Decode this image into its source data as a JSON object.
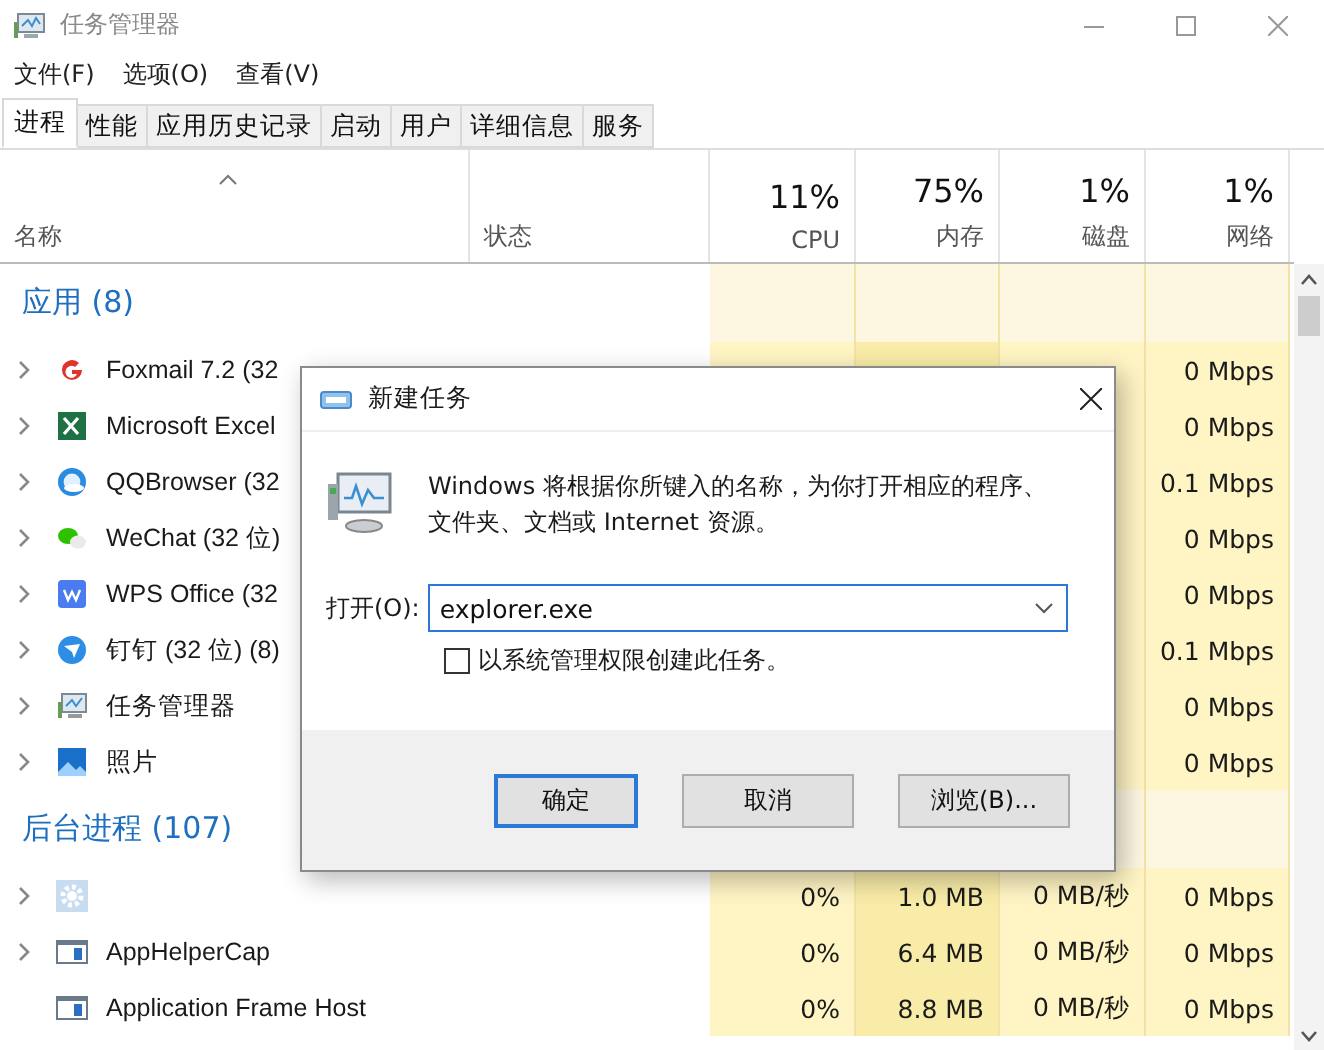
{
  "window": {
    "title": "任务管理器"
  },
  "menu": [
    "文件(F)",
    "选项(O)",
    "查看(V)"
  ],
  "tabs": [
    {
      "label": "进程",
      "selected": true
    },
    {
      "label": "性能",
      "selected": false
    },
    {
      "label": "应用历史记录",
      "selected": false
    },
    {
      "label": "启动",
      "selected": false
    },
    {
      "label": "用户",
      "selected": false
    },
    {
      "label": "详细信息",
      "selected": false
    },
    {
      "label": "服务",
      "selected": false
    }
  ],
  "columns": [
    {
      "label": "名称"
    },
    {
      "label": "状态"
    },
    {
      "label": "CPU",
      "total": "11%"
    },
    {
      "label": "内存",
      "total": "75%"
    },
    {
      "label": "磁盘",
      "total": "1%"
    },
    {
      "label": "网络",
      "total": "1%"
    }
  ],
  "groups": [
    {
      "title": "应用 (8)",
      "rows": [
        {
          "name": "Foxmail 7.2 (32",
          "expandable": true,
          "net": "0 Mbps"
        },
        {
          "name": "Microsoft Excel",
          "expandable": true,
          "net": "0 Mbps"
        },
        {
          "name": "QQBrowser (32",
          "expandable": true,
          "net": "0.1 Mbps"
        },
        {
          "name": "WeChat (32 位)",
          "expandable": true,
          "net": "0 Mbps"
        },
        {
          "name": "WPS Office (32",
          "expandable": true,
          "net": "0 Mbps"
        },
        {
          "name": "钉钉 (32 位) (8)",
          "expandable": true,
          "net": "0.1 Mbps"
        },
        {
          "name": "任务管理器",
          "expandable": true,
          "net": "0 Mbps"
        },
        {
          "name": "照片",
          "expandable": true,
          "net": "0 Mbps"
        }
      ]
    },
    {
      "title": "后台进程 (107)",
      "rows": [
        {
          "expandable": true,
          "cpu": "0%",
          "mem": "1.0 MB",
          "disk": "0 MB/秒",
          "net": "0 Mbps"
        },
        {
          "name": "AppHelperCap",
          "expandable": true,
          "cpu": "0%",
          "mem": "6.4 MB",
          "disk": "0 MB/秒",
          "net": "0 Mbps"
        },
        {
          "name": "Application Frame Host",
          "expandable": false,
          "cpu": "0%",
          "mem": "8.8 MB",
          "disk": "0 MB/秒",
          "net": "0 Mbps"
        }
      ]
    }
  ],
  "dialog": {
    "title": "新建任务",
    "message": "Windows 将根据你所键入的名称，为你打开相应的程序、文件夹、文档或 Internet 资源。",
    "open_label": "打开(O):",
    "value": "explorer.exe",
    "admin_label": "以系统管理权限创建此任务。",
    "admin_checked": false,
    "buttons": [
      {
        "label": "确定",
        "default": true
      },
      {
        "label": "取消",
        "default": false
      },
      {
        "label": "浏览(B)...",
        "default": false
      }
    ]
  }
}
